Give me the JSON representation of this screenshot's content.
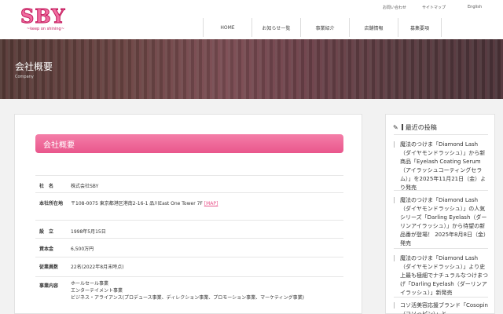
{
  "header": {
    "logo": "SBY",
    "logo_tagline": "~keep on shining~",
    "util_links": [
      "お問い合わせ",
      "サイトマップ",
      "English"
    ],
    "nav": [
      "HOME",
      "お知らせ一覧",
      "事業紹介",
      "店舗情報",
      "募集要項"
    ]
  },
  "hero": {
    "title": "会社概要",
    "subtitle": "Company"
  },
  "main": {
    "section_title": "会社概要",
    "rows": [
      {
        "label": "社　名",
        "value": "株式会社SBY"
      },
      {
        "label": "本社所在地",
        "value": "〒108-0075 東京都港区港南2-16-1 品川East One Tower 7F",
        "link": "[MAP]"
      },
      {
        "label": "設　立",
        "value": "1998年5月15日"
      },
      {
        "label": "資本金",
        "value": "6,500万円"
      },
      {
        "label": "従業員数",
        "value": "22名(2022年8月末時点)"
      },
      {
        "label": "事業内容",
        "lines": [
          "ホールセール事業",
          "エンターテイメント事業",
          "ビジネス・アライアンス(プロデュース事業、ディレクション事業、プロモーション事業、マーケティング事業)"
        ]
      }
    ]
  },
  "sidebar": {
    "icon": "pencil-icon",
    "title": "最近の投稿",
    "posts": [
      "魔法のつけま「Diamond Lash（ダイヤモンドラッシュ）」から新商品「Eyelash Coating Serum（アイラッシュコーティングセラム）」を2025年11月21日（金）より発売",
      "魔法のつけま「Diamond Lash（ダイヤモンドラッシュ）」の人気シリーズ「Darling Eyelash（ダーリンアイラッシュ）」から待望の新品番が登場！ 2025年8月8日（金）発売",
      "魔法のつけま「Diamond Lash（ダイヤモンドラッシュ）」より史上最も極細でナチュラルなつけまつげ「Darling Eyelash（ダーリンアイラッシュ）」新発売",
      "コソ活美容応援ブランド「Cosopin（コソっピン）」と"
    ]
  },
  "colors": {
    "accent": "#e9568c",
    "logo": "#f06da0"
  }
}
